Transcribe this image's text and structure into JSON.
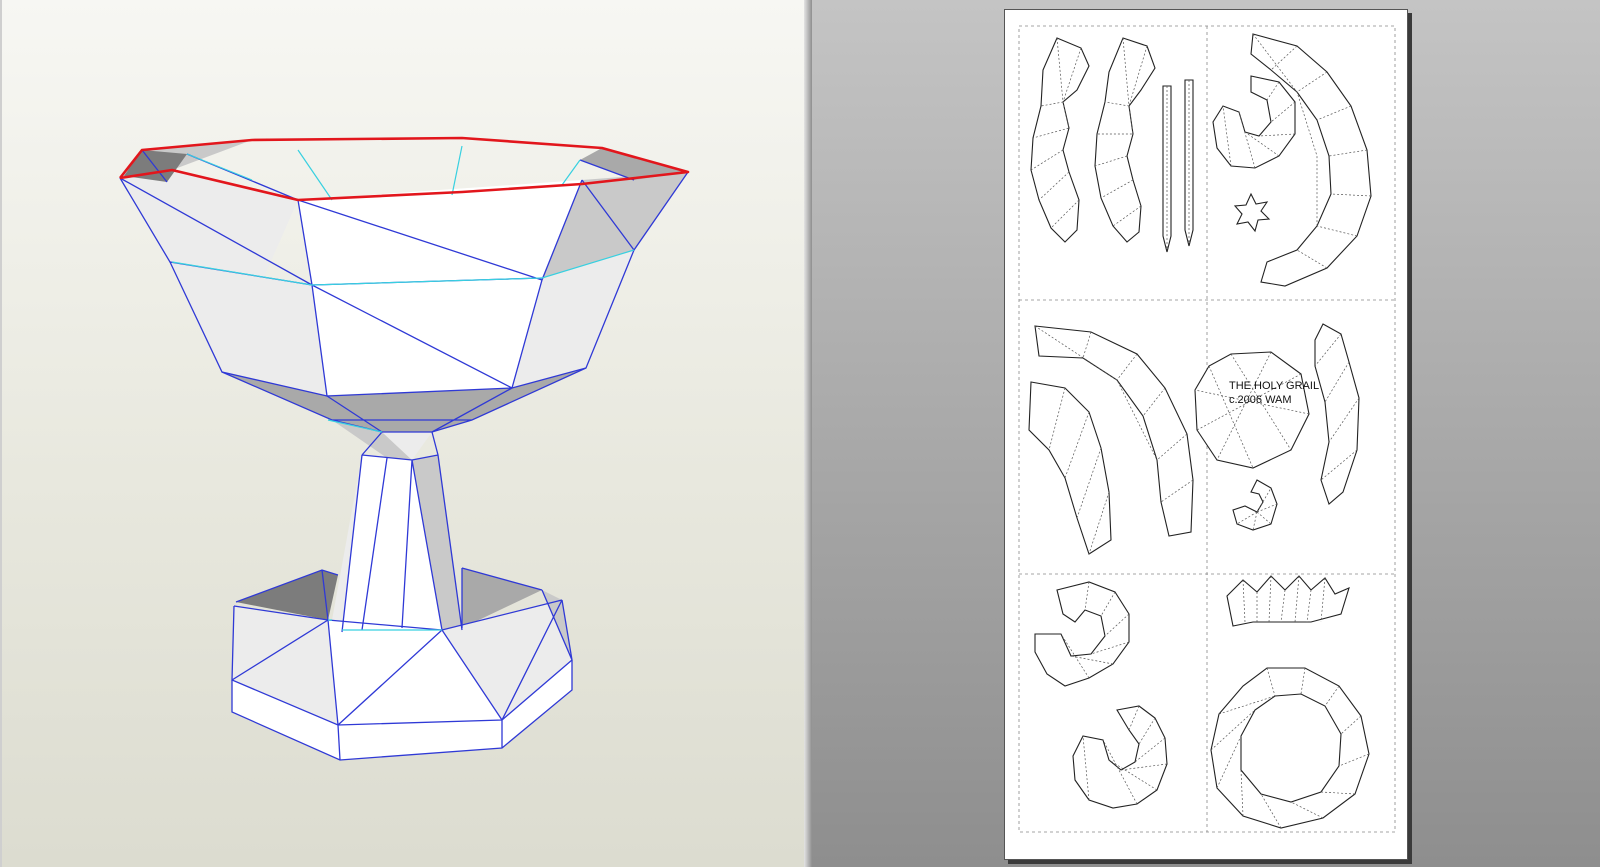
{
  "window": {
    "panes": [
      "3d-view",
      "2d-unfold-view"
    ]
  },
  "model": {
    "title_line": "THE HOLY GRAIL",
    "credit_line": "c.2006  WAM"
  },
  "colors": {
    "edge": "#2f39d6",
    "seam": "#38d0e0",
    "selected_rim": "#e2161c",
    "paper": "#ffffff"
  }
}
